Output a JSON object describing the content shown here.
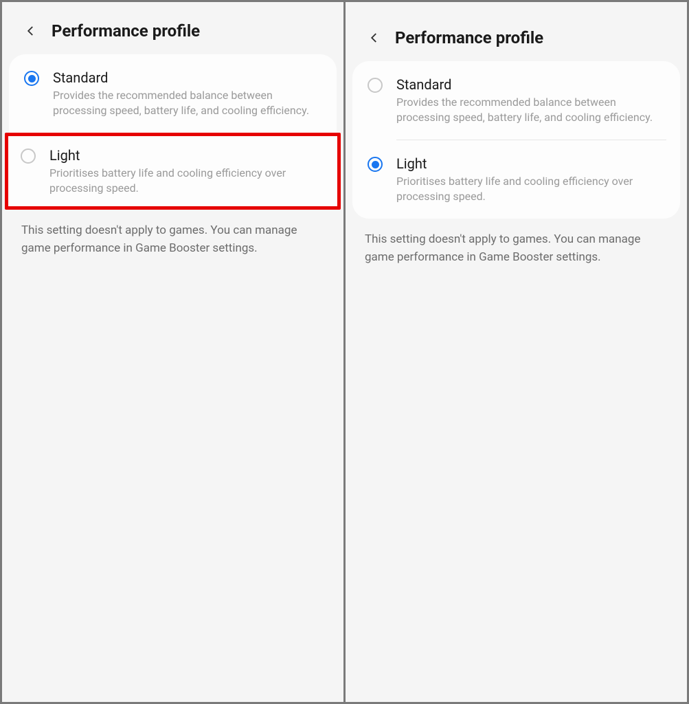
{
  "left": {
    "title": "Performance profile",
    "options": [
      {
        "title": "Standard",
        "desc": "Provides the recommended balance between processing speed, battery life, and cooling efficiency.",
        "selected": true
      },
      {
        "title": "Light",
        "desc": "Prioritises battery life and cooling efficiency over processing speed.",
        "selected": false
      }
    ],
    "note": "This setting doesn't apply to games. You can manage game performance in Game Booster settings."
  },
  "right": {
    "title": "Performance profile",
    "options": [
      {
        "title": "Standard",
        "desc": "Provides the recommended balance between processing speed, battery life, and cooling efficiency.",
        "selected": false
      },
      {
        "title": "Light",
        "desc": "Prioritises battery life and cooling efficiency over processing speed.",
        "selected": true
      }
    ],
    "note": "This setting doesn't apply to games. You can manage game performance in Game Booster settings."
  }
}
